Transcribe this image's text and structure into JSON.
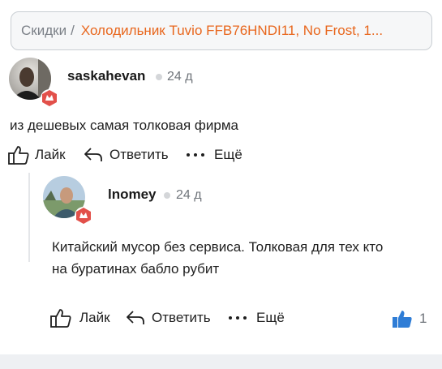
{
  "breadcrumb": {
    "root": "Скидки",
    "separator": "/",
    "current": "Холодильник  Tuvio FFB76HNDI11, No Frost, 1..."
  },
  "comment1": {
    "username": "saskahevan",
    "time": "24 д",
    "text": "из дешевых самая толковая фирма",
    "like_label": "Лайк",
    "reply_label": "Ответить",
    "more_label": "Ещё"
  },
  "comment2": {
    "username": "lnomey",
    "time": "24 д",
    "text_line1": "Китайский мусор без сервиса. Толковая для тех кто",
    "text_line2": "на буратинах бабло рубит",
    "like_label": "Лайк",
    "reply_label": "Ответить",
    "more_label": "Ещё",
    "like_count": "1"
  },
  "colors": {
    "accent": "#e8661c",
    "badge": "#e2504a",
    "like_blue": "#2f7dd6"
  },
  "icons": [
    "like-icon",
    "reply-icon",
    "more-icon",
    "like-filled-icon",
    "level-badge-icon"
  ]
}
